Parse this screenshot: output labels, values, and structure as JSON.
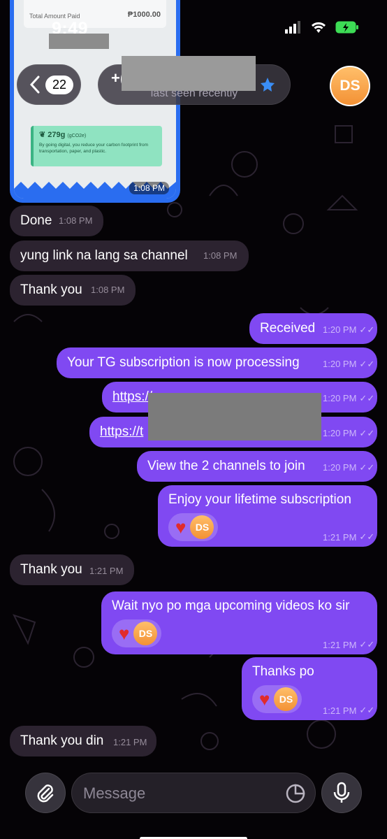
{
  "status_bar": {
    "time": "9:49"
  },
  "header": {
    "back_count": "22",
    "name": "+(",
    "subtitle": "last seen recently",
    "avatar_initials": "DS"
  },
  "top_image": {
    "amount": "₱1000.00",
    "eco_value": "279g",
    "eco_unit": "(gCO2e)",
    "eco_text": "By going digital, you reduce your carbon footprint from transportation, paper, and plastic.",
    "time": "1:08 PM"
  },
  "messages": [
    {
      "dir": "in",
      "text": "Done",
      "time": "1:08 PM"
    },
    {
      "dir": "in",
      "text": "yung link na lang sa channel",
      "time": "1:08 PM"
    },
    {
      "dir": "in",
      "text": "Thank you",
      "time": "1:08 PM"
    },
    {
      "dir": "out",
      "text": "Received",
      "time": "1:20 PM"
    },
    {
      "dir": "out",
      "text": "Your TG subscription is now processing",
      "time": "1:20 PM"
    },
    {
      "dir": "out",
      "text": "https://",
      "time": "1:20 PM"
    },
    {
      "dir": "out",
      "text": "https://t",
      "time": "1:20 PM"
    },
    {
      "dir": "out",
      "text": "View the 2 channels to join",
      "time": "1:20 PM"
    },
    {
      "dir": "out",
      "text": "Enjoy your lifetime subscription",
      "time": "1:21 PM",
      "reaction": "DS"
    },
    {
      "dir": "in",
      "text": "Thank you",
      "time": "1:21 PM"
    },
    {
      "dir": "out",
      "text": "Wait nyo po mga upcoming videos ko sir",
      "time": "1:21 PM",
      "reaction": "DS"
    },
    {
      "dir": "out",
      "text": "Thanks po",
      "time": "1:21 PM",
      "reaction": "DS"
    },
    {
      "dir": "in",
      "text": "Thank you din",
      "time": "1:21 PM"
    }
  ],
  "composer": {
    "placeholder": "Message"
  },
  "colors": {
    "outgoing": "#8049f2",
    "incoming": "#2c2330",
    "accent": "#2a6df0"
  }
}
